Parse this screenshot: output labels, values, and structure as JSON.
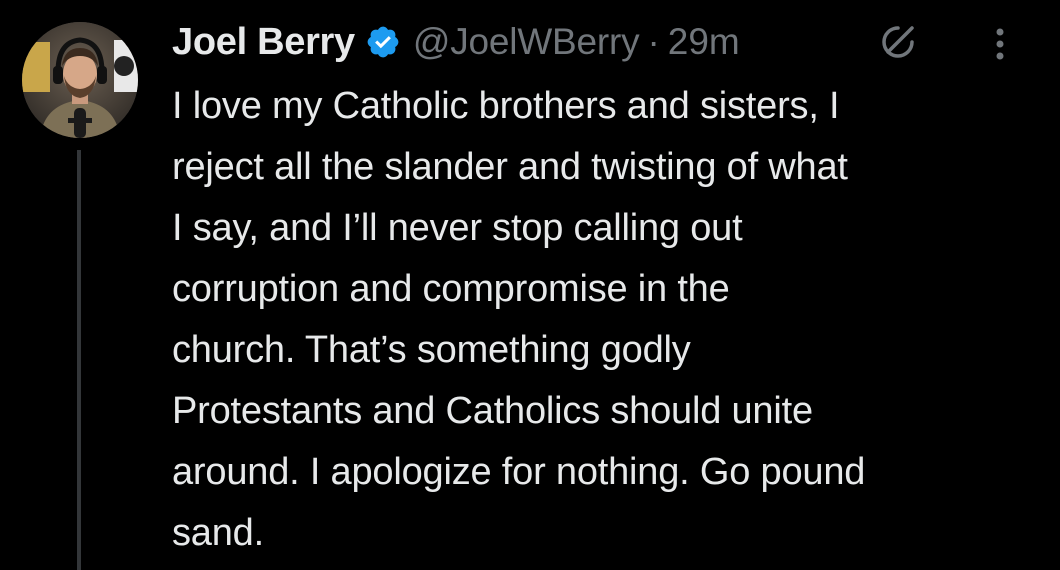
{
  "tweet": {
    "author": {
      "display_name": "Joel Berry",
      "handle": "@JoelWBerry",
      "verified": true,
      "avatar_icon": "avatar-photo"
    },
    "separator": "·",
    "time_ago": "29m",
    "icons": {
      "verified": "verified-badge-icon",
      "grok": "grok-slash-icon",
      "more": "more-vertical-icon"
    },
    "text": "I love my Catholic brothers and sisters, I\nreject all the slander and twisting of what\nI say, and I’ll never stop calling out\ncorruption and compromise in the\nchurch. That’s something godly\nProtestants and Catholics should unite\naround. I apologize for nothing. Go pound\nsand."
  },
  "colors": {
    "background": "#000000",
    "primary_text": "#e7e9ea",
    "secondary_text": "#71767b",
    "verified_blue": "#1d9bf0",
    "thread_line": "#333639"
  }
}
